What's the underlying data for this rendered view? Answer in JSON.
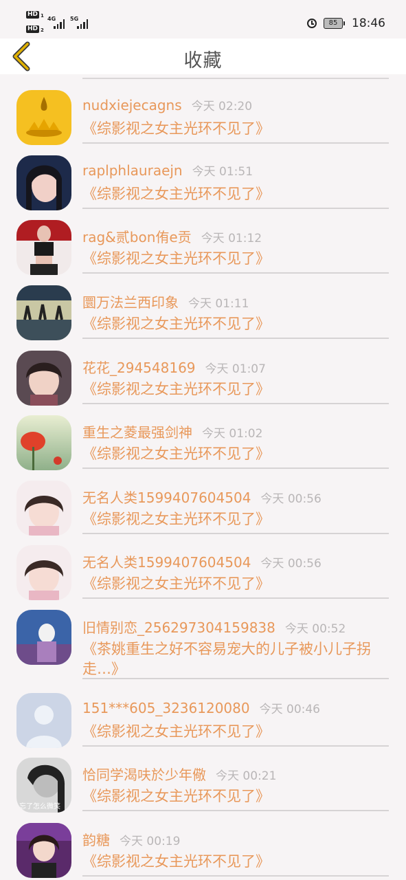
{
  "status_bar": {
    "sim1": "HD",
    "sim1_index": "1",
    "sim2": "HD",
    "sim2_index": "2",
    "net1": "4G",
    "net2": "5G",
    "battery": "85",
    "time": "18:46"
  },
  "header": {
    "title": "收藏"
  },
  "items": [
    {
      "name": "nudxiejecagns",
      "time": "今天 02:20",
      "book": "《综影视之女主光环不见了》",
      "avatar": "gold-droplet"
    },
    {
      "name": "raplphlauraejn",
      "time": "今天 01:51",
      "book": "《综影视之女主光环不见了》",
      "avatar": "girl-dark"
    },
    {
      "name": "rag&贰bon侑e贡",
      "time": "今天 01:12",
      "book": "《综影视之女主光环不见了》",
      "avatar": "girl-red"
    },
    {
      "name": "圜万法兰西印象",
      "time": "今天 01:11",
      "book": "《综影视之女主光环不见了》",
      "avatar": "dancers"
    },
    {
      "name": "花花_294548169",
      "time": "今天 01:07",
      "book": "《综影视之女主光环不见了》",
      "avatar": "child-dark"
    },
    {
      "name": "重生之菱最强剑神",
      "time": "今天 01:02",
      "book": "《综影视之女主光环不见了》",
      "avatar": "red-flower"
    },
    {
      "name": "无名人类1599407604504",
      "time": "今天 00:56",
      "book": "《综影视之女主光环不见了》",
      "avatar": "child-pink"
    },
    {
      "name": "无名人类1599407604504",
      "time": "今天 00:56",
      "book": "《综影视之女主光环不见了》",
      "avatar": "child-pink"
    },
    {
      "name": "旧情别恋_256297304159838",
      "time": "今天 00:52",
      "book": "《茶姚重生之好不容易宠大的儿子被小儿子拐走…》",
      "avatar": "girl-blue"
    },
    {
      "name": "151***605_3236120080",
      "time": "今天 00:46",
      "book": "《综影视之女主光环不见了》",
      "avatar": "default-user"
    },
    {
      "name": "恰同学渴呋於少年儆",
      "time": "今天 00:21",
      "book": "《综影视之女主光环不见了》",
      "avatar": "bw-girl",
      "avatar_caption": "忘了怎么微笑"
    },
    {
      "name": "韵糖",
      "time": "今天 00:19",
      "book": "《综影视之女主光环不见了》",
      "avatar": "girl-purple"
    }
  ],
  "colors": {
    "accent": "#e8985a",
    "muted": "#b9b6b7",
    "back_arrow": "#e1b100"
  }
}
